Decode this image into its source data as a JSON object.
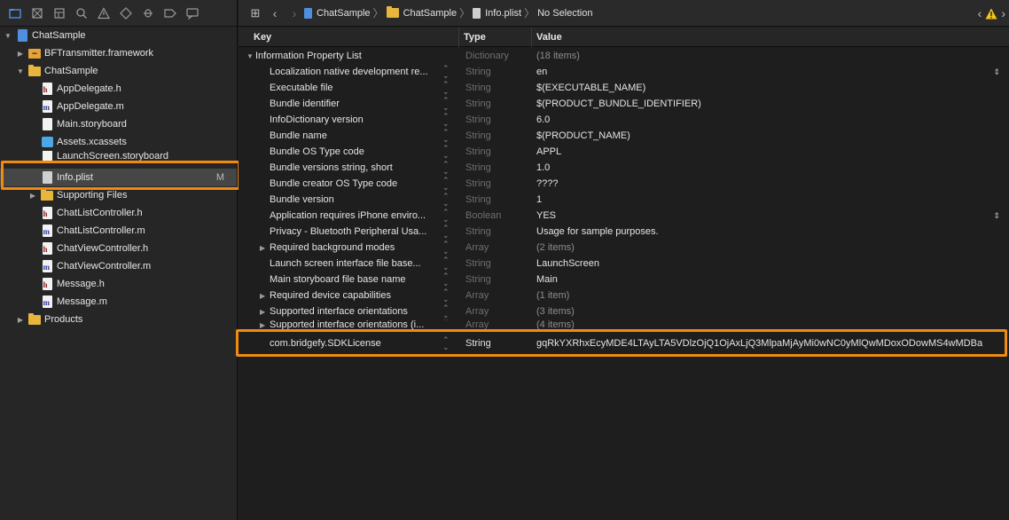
{
  "navigator": {
    "toolbar_icons": [
      "folder-icon",
      "source-control-icon",
      "hierarchy-icon",
      "search-icon",
      "warning-icon",
      "test-icon",
      "debug-icon",
      "breakpoint-icon",
      "report-icon"
    ],
    "items": [
      {
        "label": "ChatSample",
        "icon": "project",
        "badge": ""
      },
      {
        "label": "BFTransmitter.framework",
        "icon": "framework",
        "badge": ""
      },
      {
        "label": "ChatSample",
        "icon": "folder",
        "badge": ""
      },
      {
        "label": "AppDelegate.h",
        "icon": "h",
        "badge": ""
      },
      {
        "label": "AppDelegate.m",
        "icon": "m",
        "badge": ""
      },
      {
        "label": "Main.storyboard",
        "icon": "storyboard",
        "badge": ""
      },
      {
        "label": "Assets.xcassets",
        "icon": "assets",
        "badge": ""
      },
      {
        "label": "LaunchScreen.storyboard",
        "icon": "storyboard",
        "badge": ""
      },
      {
        "label": "Info.plist",
        "icon": "plist",
        "badge": "M"
      },
      {
        "label": "Supporting Files",
        "icon": "folder",
        "badge": ""
      },
      {
        "label": "ChatListController.h",
        "icon": "h",
        "badge": ""
      },
      {
        "label": "ChatListController.m",
        "icon": "m",
        "badge": ""
      },
      {
        "label": "ChatViewController.h",
        "icon": "h",
        "badge": ""
      },
      {
        "label": "ChatViewController.m",
        "icon": "m",
        "badge": ""
      },
      {
        "label": "Message.h",
        "icon": "h",
        "badge": ""
      },
      {
        "label": "Message.m",
        "icon": "m",
        "badge": ""
      },
      {
        "label": "Products",
        "icon": "folder",
        "badge": ""
      }
    ]
  },
  "jumpbar": {
    "crumbs": [
      "ChatSample",
      "ChatSample",
      "Info.plist",
      "No Selection"
    ]
  },
  "plist": {
    "headers": {
      "key": "Key",
      "type": "Type",
      "value": "Value"
    },
    "rows": [
      {
        "key": "Information Property List",
        "type": "Dictionary",
        "value": "(18 items)"
      },
      {
        "key": "Localization native development re...",
        "type": "String",
        "value": "en"
      },
      {
        "key": "Executable file",
        "type": "String",
        "value": "$(EXECUTABLE_NAME)"
      },
      {
        "key": "Bundle identifier",
        "type": "String",
        "value": "$(PRODUCT_BUNDLE_IDENTIFIER)"
      },
      {
        "key": "InfoDictionary version",
        "type": "String",
        "value": "6.0"
      },
      {
        "key": "Bundle name",
        "type": "String",
        "value": "$(PRODUCT_NAME)"
      },
      {
        "key": "Bundle OS Type code",
        "type": "String",
        "value": "APPL"
      },
      {
        "key": "Bundle versions string, short",
        "type": "String",
        "value": "1.0"
      },
      {
        "key": "Bundle creator OS Type code",
        "type": "String",
        "value": "????"
      },
      {
        "key": "Bundle version",
        "type": "String",
        "value": "1"
      },
      {
        "key": "Application requires iPhone enviro...",
        "type": "Boolean",
        "value": "YES"
      },
      {
        "key": "Privacy - Bluetooth Peripheral Usa...",
        "type": "String",
        "value": "Usage for sample purposes."
      },
      {
        "key": "Required background modes",
        "type": "Array",
        "value": "(2 items)"
      },
      {
        "key": "Launch screen interface file base...",
        "type": "String",
        "value": "LaunchScreen"
      },
      {
        "key": "Main storyboard file base name",
        "type": "String",
        "value": "Main"
      },
      {
        "key": "Required device capabilities",
        "type": "Array",
        "value": "(1 item)"
      },
      {
        "key": "Supported interface orientations",
        "type": "Array",
        "value": "(3 items)"
      },
      {
        "key": "Supported interface orientations (i...",
        "type": "Array",
        "value": "(4 items)"
      },
      {
        "key": "com.bridgefy.SDKLicense",
        "type": "String",
        "value": "gqRkYXRhxEcyMDE4LTAyLTA5VDlzOjQ1OjAxLjQ3MlpaMjAyMi0wNC0yMlQwMDoxODowMS4wMDBa"
      }
    ]
  },
  "colors": {
    "highlight": "#f08a12",
    "accent": "#4a90e2",
    "warning": "#f5c518"
  }
}
